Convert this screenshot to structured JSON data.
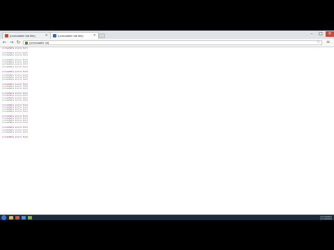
{
  "browser": {
    "tabs": [
      {
        "title": "(unreadable tab title)",
        "active": false
      },
      {
        "title": "(unreadable tab title)",
        "active": true
      }
    ],
    "address_url": "(unreadable url)",
    "window_controls": {
      "minimize": "–",
      "maximize": "□",
      "close": "✕"
    }
  },
  "source_view": {
    "lines": [
      {
        "text": "(unreadable source text)",
        "kind": "tag"
      },
      {
        "text": "(unreadable source text)",
        "kind": "text"
      },
      {
        "text": "(unreadable source text)",
        "kind": "text"
      },
      {
        "text": "(unreadable source text)",
        "kind": "text"
      },
      {
        "text": "(unreadable source text)",
        "kind": "text"
      },
      {
        "text": "(unreadable source text)",
        "kind": "text"
      },
      {
        "text": "(unreadable source text)",
        "kind": "text"
      },
      {
        "text": "(unreadable source text)",
        "kind": "tag"
      },
      {
        "text": "(unreadable source text)",
        "kind": "text"
      },
      {
        "text": "(unreadable source text)",
        "kind": "text"
      },
      {
        "text": "(unreadable source text)",
        "kind": "text"
      },
      {
        "text": "(unreadable source text)",
        "kind": "tag"
      },
      {
        "text": "(unreadable source text)",
        "kind": "text"
      },
      {
        "text": "(unreadable source text)",
        "kind": "text"
      },
      {
        "text": "(unreadable source text)",
        "kind": "tag"
      },
      {
        "text": "(unreadable source text)",
        "kind": "text"
      },
      {
        "text": "(unreadable source text)",
        "kind": "text"
      },
      {
        "text": "(unreadable source text)",
        "kind": "text"
      },
      {
        "text": "(unreadable source text)",
        "kind": "tag"
      },
      {
        "text": "(unreadable source text)",
        "kind": "text"
      },
      {
        "text": "(unreadable source text)",
        "kind": "text"
      },
      {
        "text": "(unreadable source text)",
        "kind": "text"
      },
      {
        "text": "(unreadable source text)",
        "kind": "tag"
      },
      {
        "text": "(unreadable source text)",
        "kind": "text"
      },
      {
        "text": "(unreadable source text)",
        "kind": "text"
      },
      {
        "text": "(unreadable source text)",
        "kind": "text"
      },
      {
        "text": "(unreadable source text)",
        "kind": "tag"
      },
      {
        "text": "(unreadable source text)",
        "kind": "text"
      },
      {
        "text": "(unreadable source text)",
        "kind": "text"
      },
      {
        "text": "(unreadable source text)",
        "kind": "tag"
      }
    ]
  },
  "taskbar": {
    "clock_time": "(unreadable)",
    "clock_date": "(unreadable)",
    "icons": [
      "explorer-icon",
      "browser-icon",
      "folder-icon",
      "app-icon"
    ]
  },
  "colors": {
    "tab_favicon_1": "#c94b2b",
    "tab_favicon_2": "#2d6fc3",
    "taskbar": "#1d2a3a",
    "source_tag": "#881280",
    "source_text": "#6a6a6a"
  }
}
